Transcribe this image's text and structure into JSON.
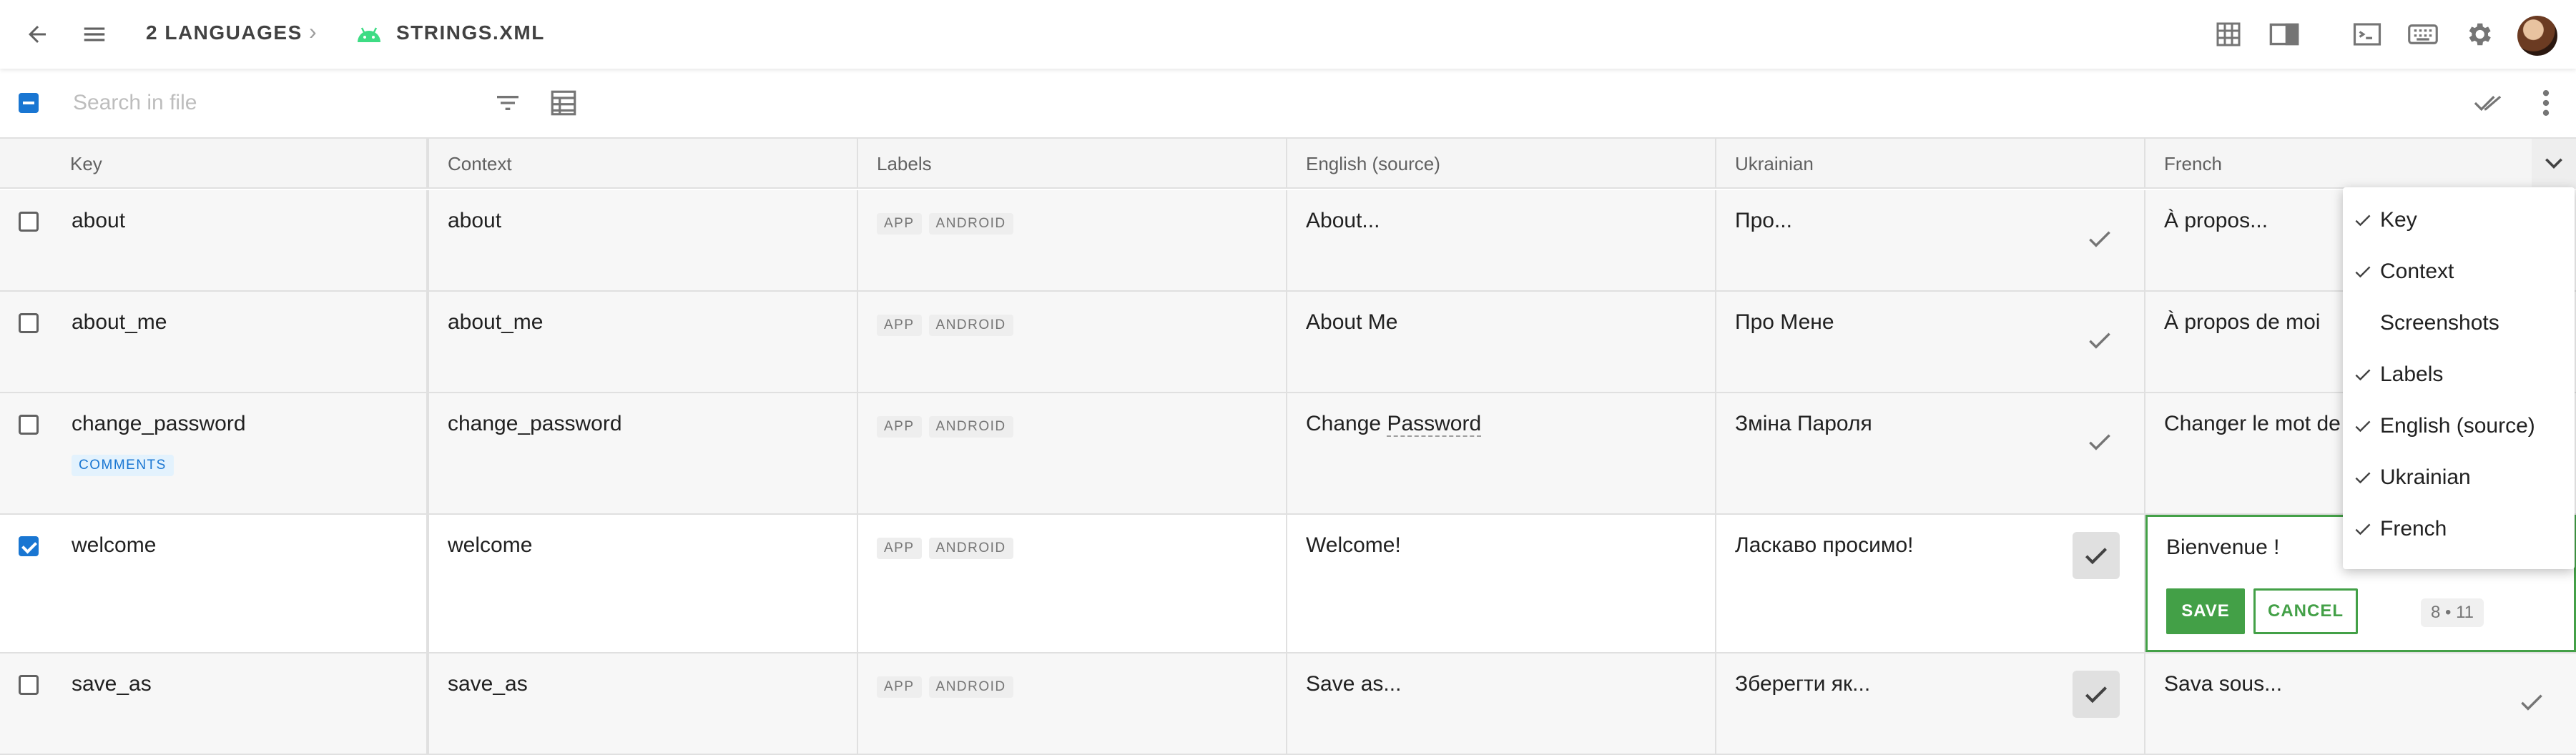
{
  "header": {
    "project_crumb": "2 LANGUAGES",
    "file_crumb": "STRINGS.XML",
    "icons": [
      "back-arrow-icon",
      "menu-icon",
      "android-icon",
      "grid-view-icon",
      "side-panel-icon",
      "terminal-icon",
      "keyboard-icon",
      "gear-icon",
      "avatar"
    ]
  },
  "toolbar": {
    "search_placeholder": "Search in file",
    "icons": [
      "filter-icon",
      "table-icon",
      "double-check-icon",
      "more-vert-icon"
    ]
  },
  "columns": [
    "Key",
    "Context",
    "Labels",
    "English (source)",
    "Ukrainian",
    "French"
  ],
  "rows": [
    {
      "key": "about",
      "context": "about",
      "labels": [
        "APP",
        "ANDROID"
      ],
      "en": "About...",
      "uk": "Про...",
      "fr": "À propos...",
      "selected": false
    },
    {
      "key": "about_me",
      "context": "about_me",
      "labels": [
        "APP",
        "ANDROID"
      ],
      "en": "About Me",
      "uk": "Про Мене",
      "fr": "À propos de moi",
      "selected": false
    },
    {
      "key": "change_password",
      "context": "change_password",
      "labels": [
        "APP",
        "ANDROID"
      ],
      "en_a": "Change ",
      "en_b": "Password",
      "uk": "Зміна Пароля",
      "fr": "Changer le mot de",
      "badge": "COMMENTS",
      "selected": false
    },
    {
      "key": "welcome",
      "context": "welcome",
      "labels": [
        "APP",
        "ANDROID"
      ],
      "en": "Welcome!",
      "uk": "Ласкаво просимо!",
      "fr": "Bienvenue !",
      "selected": true
    },
    {
      "key": "save_as",
      "context": "save_as",
      "labels": [
        "APP",
        "ANDROID"
      ],
      "en": "Save as...",
      "uk": "Зберегти як...",
      "fr": "Sava sous...",
      "selected": false
    }
  ],
  "editor": {
    "save_label": "SAVE",
    "cancel_label": "CANCEL",
    "counter_a": "8",
    "counter_sep": "•",
    "counter_b": "11"
  },
  "column_menu": {
    "items": [
      {
        "label": "Key",
        "checked": true
      },
      {
        "label": "Context",
        "checked": true
      },
      {
        "label": "Screenshots",
        "checked": false
      },
      {
        "label": "Labels",
        "checked": true
      },
      {
        "label": "English (source)",
        "checked": true
      },
      {
        "label": "Ukrainian",
        "checked": true
      },
      {
        "label": "French",
        "checked": true
      }
    ]
  },
  "colors": {
    "accent_green": "#43a047",
    "accent_blue": "#1976d2",
    "android_green": "#3ddc84"
  }
}
